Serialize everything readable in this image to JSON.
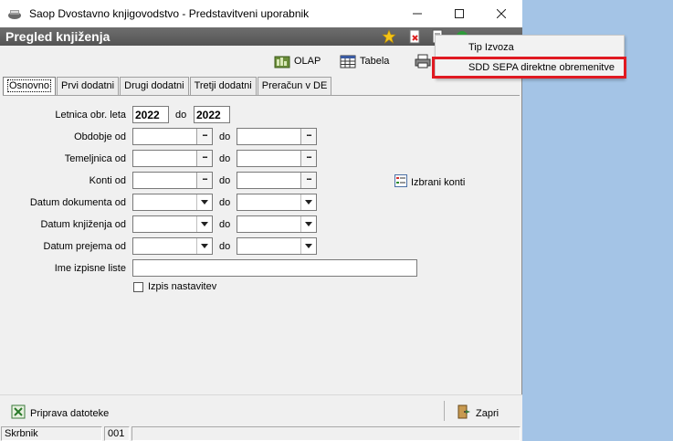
{
  "window": {
    "title": "Saop Dvostavno knjigovodstvo - Predstavitveni uporabnik",
    "controls": [
      "minimize-icon",
      "maximize-icon",
      "close-icon"
    ]
  },
  "caption": {
    "title": "Pregled knjiženja",
    "icons": [
      "star-icon",
      "document-delete-icon",
      "export-icon",
      "green-icon"
    ]
  },
  "toolbar": {
    "olap_label": "OLAP",
    "tabela_label": "Tabela"
  },
  "tabs": [
    {
      "label": "Osnovno",
      "active": true
    },
    {
      "label": "Prvi dodatni",
      "active": false
    },
    {
      "label": "Drugi dodatni",
      "active": false
    },
    {
      "label": "Tretji dodatni",
      "active": false
    },
    {
      "label": "Preračun v DE",
      "active": false
    }
  ],
  "form": {
    "letnica_label": "Letnica obr. leta",
    "letnica_from": "2022",
    "letnica_to": "2022",
    "do_label": "do",
    "obdobje_label": "Obdobje od",
    "temeljnica_label": "Temeljnica od",
    "konti_label": "Konti od",
    "datum_dokumenta_label": "Datum dokumenta od",
    "datum_knjizenja_label": "Datum knjiženja od",
    "datum_prejema_label": "Datum prejema od",
    "ime_izpisne_label": "Ime izpisne liste",
    "ime_izpisne_value": "",
    "izpis_nastavitev_label": "Izpis nastavitev",
    "izpis_nastavitev_checked": false,
    "izbrani_konti_label": "Izbrani konti"
  },
  "bottom": {
    "priprava_label": "Priprava datoteke",
    "zapri_label": "Zapri"
  },
  "status": {
    "cell1": "Skrbnik",
    "cell2": "001",
    "cell3": ""
  },
  "popup_menu": {
    "items": [
      {
        "label": "Tip Izvoza",
        "highlighted": false
      },
      {
        "label": "SDD SEPA direktne obremenitve",
        "highlighted": true
      }
    ],
    "highlight_color": "#e01a22"
  },
  "colors": {
    "caption_bg": "#5a5a5a",
    "desktop_bg": "#a4c4e6",
    "window_bg": "#f0f0f0"
  }
}
